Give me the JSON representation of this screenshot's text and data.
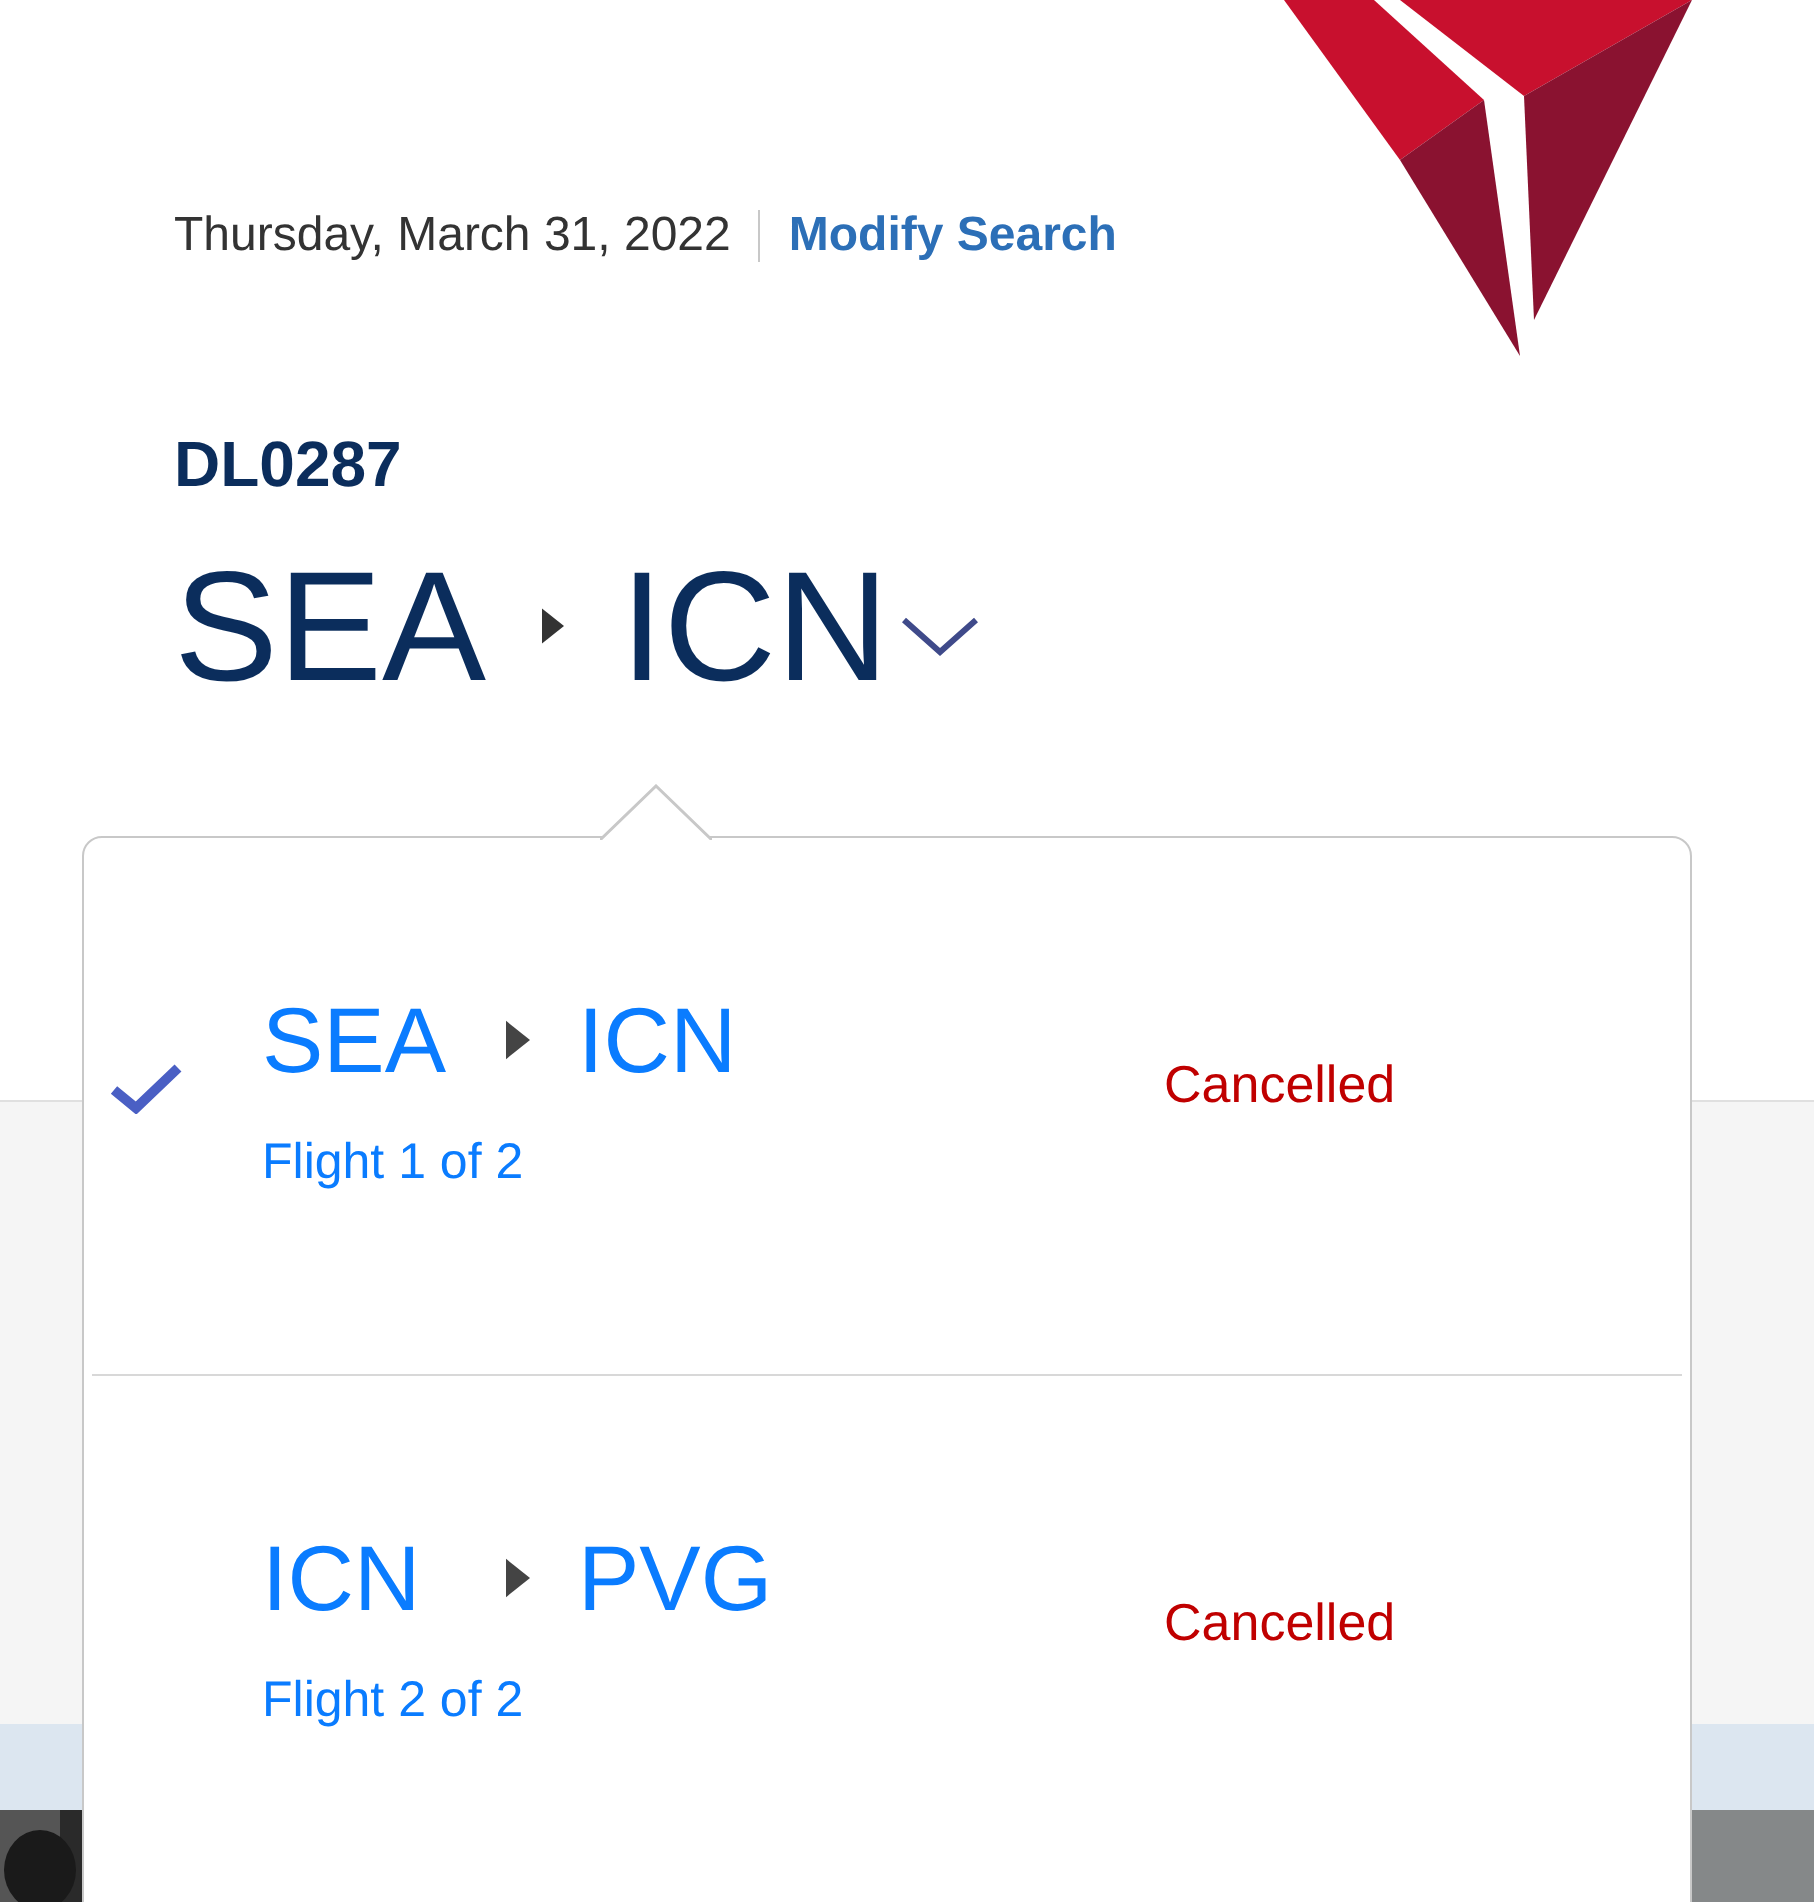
{
  "header": {
    "date": "Thursday, March 31, 2022",
    "modify_link": "Modify Search"
  },
  "flight_number": "DL0287",
  "route": {
    "origin": "SEA",
    "destination": "ICN",
    "expanded": true
  },
  "segments": [
    {
      "origin": "SEA",
      "destination": "ICN",
      "status": "Cancelled",
      "label": "Flight 1 of 2",
      "selected": true
    },
    {
      "origin": "ICN",
      "destination": "PVG",
      "status": "Cancelled",
      "label": "Flight 2 of 2",
      "selected": false
    }
  ]
}
